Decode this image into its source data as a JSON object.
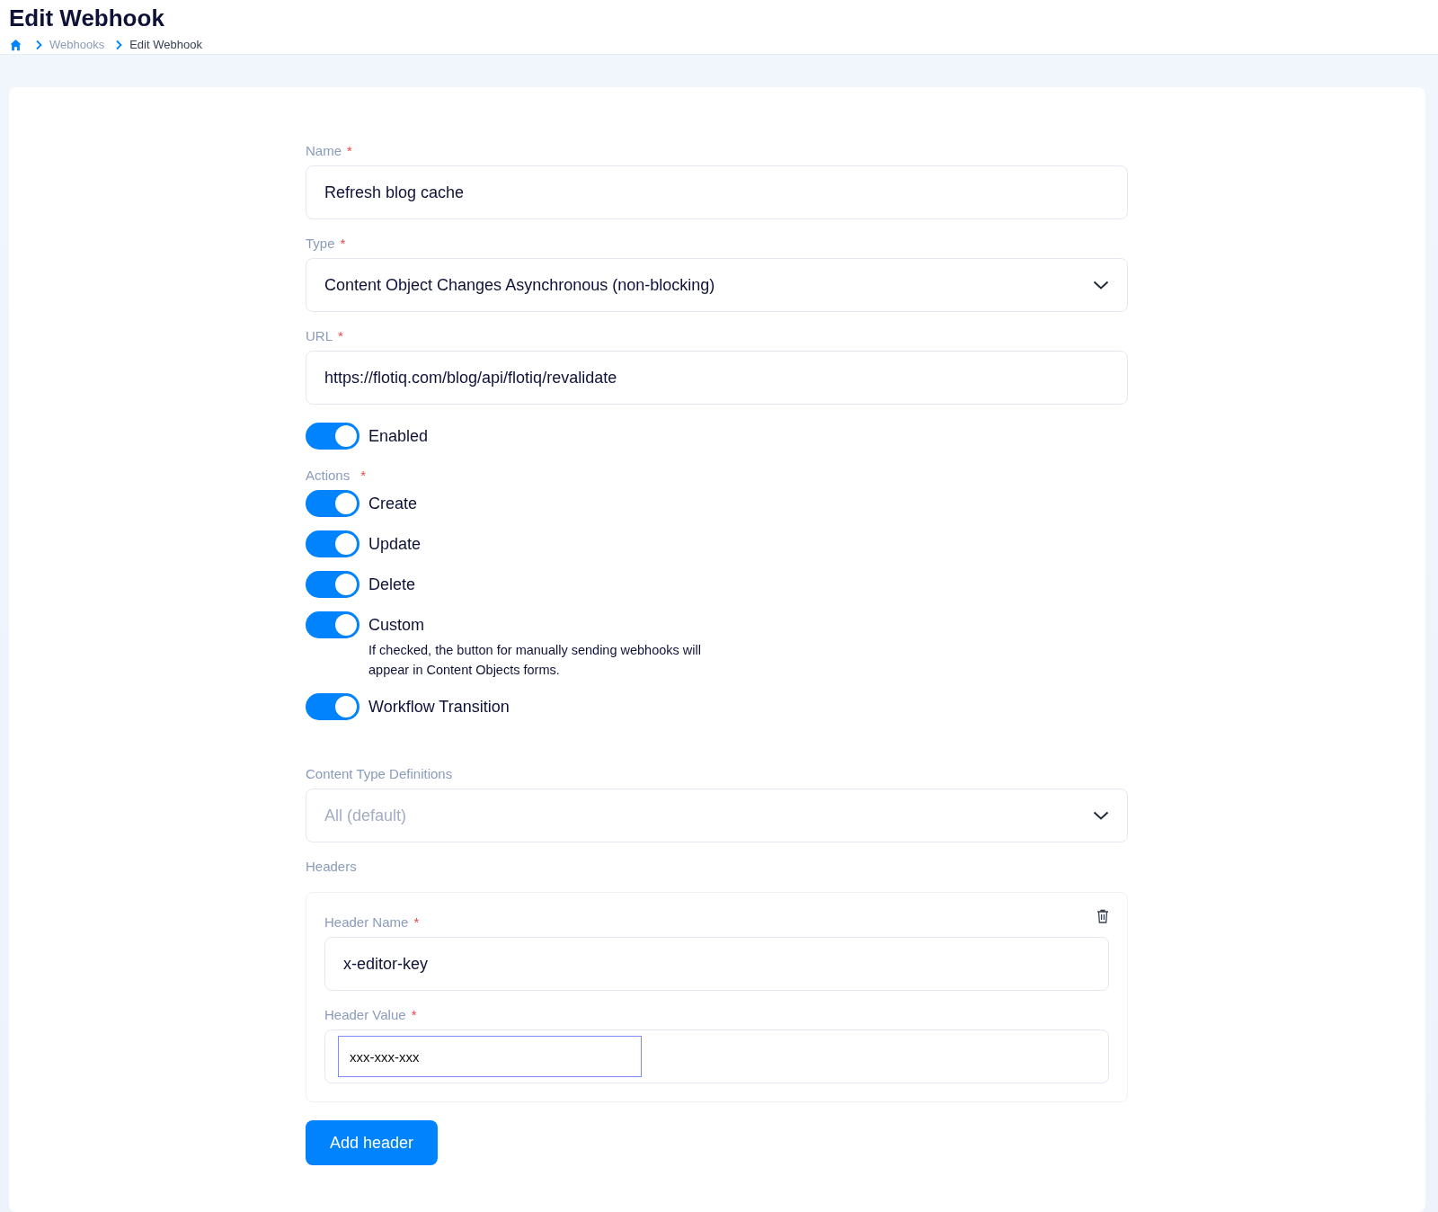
{
  "page": {
    "title": "Edit Webhook"
  },
  "breadcrumb": [
    {
      "label": "Webhooks",
      "current": false
    },
    {
      "label": "Edit Webhook",
      "current": true
    }
  ],
  "form": {
    "name": {
      "label": "Name",
      "required_mark": "*",
      "value": "Refresh blog cache"
    },
    "type": {
      "label": "Type",
      "required_mark": "*",
      "value": "Content Object Changes Asynchronous (non-blocking)"
    },
    "url": {
      "label": "URL",
      "required_mark": "*",
      "value": "https://flotiq.com/blog/api/flotiq/revalidate"
    },
    "enabled": {
      "label": "Enabled",
      "on": true
    },
    "actions": {
      "label": "Actions",
      "required_mark": "*",
      "items": [
        {
          "label": "Create",
          "on": true
        },
        {
          "label": "Update",
          "on": true
        },
        {
          "label": "Delete",
          "on": true
        },
        {
          "label": "Custom",
          "on": true,
          "help": "If checked, the button for manually sending webhooks will appear in Content Objects forms."
        },
        {
          "label": "Workflow Transition",
          "on": true
        }
      ]
    },
    "content_type_definitions": {
      "label": "Content Type Definitions",
      "placeholder": "All (default)"
    },
    "headers": {
      "label": "Headers",
      "items": [
        {
          "name_label": "Header Name",
          "name_required_mark": "*",
          "name_value": "x-editor-key",
          "value_label": "Header Value",
          "value_required_mark": "*",
          "value_value": "xxx-xxx-xxx"
        }
      ]
    },
    "add_header_button": "Add header"
  }
}
